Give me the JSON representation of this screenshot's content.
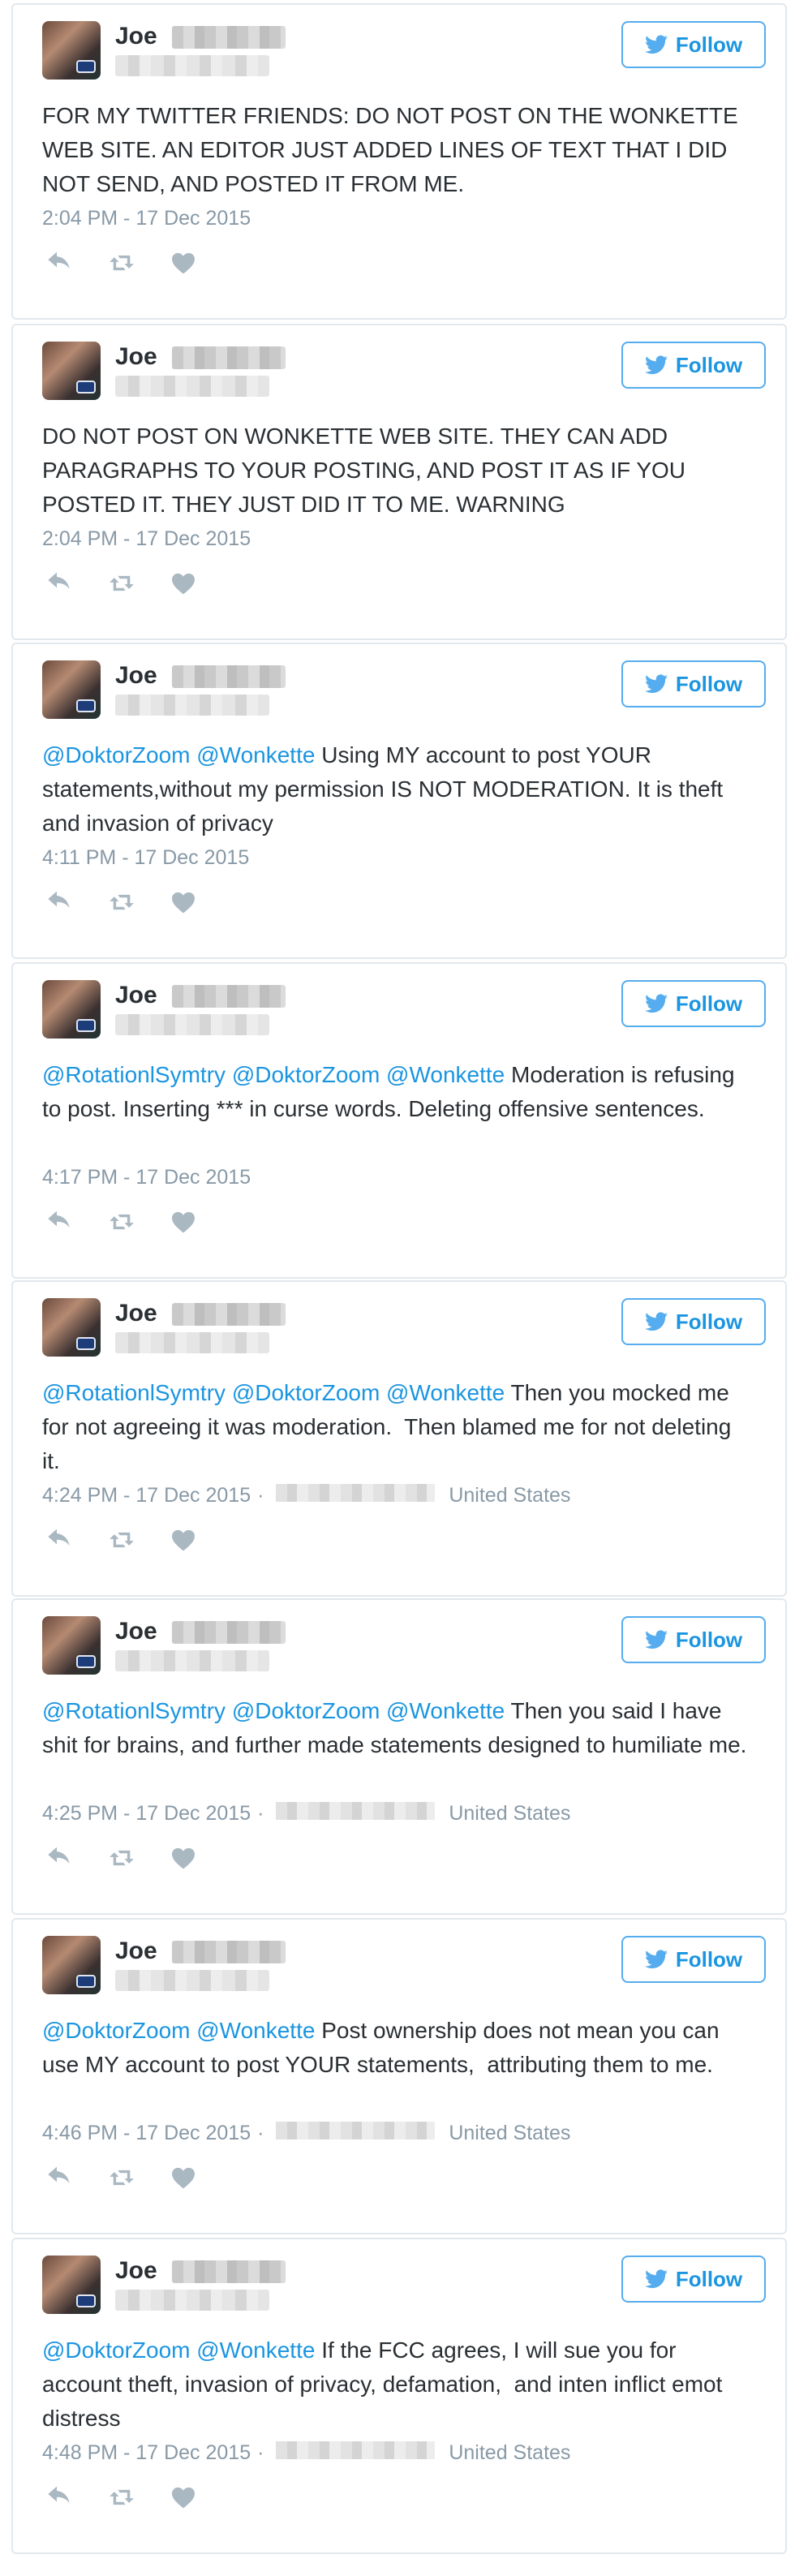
{
  "colors": {
    "link": "#1b95e0",
    "follow_border": "#55acee",
    "text": "#292f33",
    "muted": "#8899a6",
    "card_border": "#e1e8ed"
  },
  "icons": {
    "follow": "twitter-bird-icon",
    "reply": "reply-icon",
    "retweet": "retweet-icon",
    "like": "heart-icon"
  },
  "tweets": [
    {
      "name": "Joe",
      "follow_label": "Follow",
      "text": "FOR MY TWITTER FRIENDS: DO NOT POST ON THE WONKETTE WEB SITE. AN EDITOR JUST ADDED LINES OF TEXT THAT I DID NOT SEND, AND POSTED IT FROM ME.",
      "time": "2:04 PM - 17 Dec 2015",
      "location_country": ""
    },
    {
      "name": "Joe",
      "follow_label": "Follow",
      "text": "DO NOT POST ON WONKETTE WEB SITE. THEY CAN ADD PARAGRAPHS TO YOUR POSTING, AND POST IT AS IF YOU POSTED IT. THEY JUST DID IT TO ME. WARNING",
      "time": "2:04 PM - 17 Dec 2015",
      "location_country": ""
    },
    {
      "name": "Joe",
      "follow_label": "Follow",
      "mentions": "@DoktorZoom @Wonkette",
      "text": " Using MY account to post YOUR statements,without my permission IS NOT MODERATION. It is theft and invasion of privacy",
      "time": "4:11 PM - 17 Dec 2015",
      "location_country": ""
    },
    {
      "name": "Joe",
      "follow_label": "Follow",
      "mentions": "@RotationlSymtry @DoktorZoom @Wonkette",
      "text": " Moderation is refusing to post. Inserting *** in curse words. Deleting offensive sentences.",
      "time": "4:17 PM - 17 Dec 2015",
      "location_country": ""
    },
    {
      "name": "Joe",
      "follow_label": "Follow",
      "mentions": "@RotationlSymtry @DoktorZoom @Wonkette",
      "text": " Then you mocked me for not agreeing it was moderation.  Then blamed me for not deleting it.",
      "time": "4:24 PM - 17 Dec 2015",
      "location_country": "United States"
    },
    {
      "name": "Joe",
      "follow_label": "Follow",
      "mentions": "@RotationlSymtry @DoktorZoom @Wonkette",
      "text": " Then you said I have shit for brains, and further made statements designed to humiliate me.",
      "time": "4:25 PM - 17 Dec 2015",
      "location_country": "United States"
    },
    {
      "name": "Joe",
      "follow_label": "Follow",
      "mentions": "@DoktorZoom @Wonkette",
      "text": " Post ownership does not mean you can use MY account to post YOUR statements,  attributing them to me.",
      "time": "4:46 PM - 17 Dec 2015",
      "location_country": "United States"
    },
    {
      "name": "Joe",
      "follow_label": "Follow",
      "mentions": "@DoktorZoom @Wonkette",
      "text": " If the FCC agrees, I will sue you for account theft, invasion of privacy, defamation,  and inten inflict emot distress",
      "time": "4:48 PM - 17 Dec 2015",
      "location_country": "United States"
    }
  ]
}
